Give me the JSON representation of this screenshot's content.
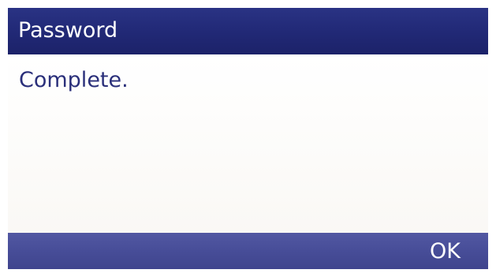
{
  "dialog": {
    "title": "Password",
    "message": "Complete."
  },
  "softkeys": [
    {
      "label": ""
    },
    {
      "label": ""
    },
    {
      "label": ""
    },
    {
      "label": "OK"
    }
  ],
  "colors": {
    "title_bar": "#222a78",
    "softkey_bar": "#474d98",
    "message_text": "#2a2f7a",
    "content_bg": "#fdfcfb"
  }
}
